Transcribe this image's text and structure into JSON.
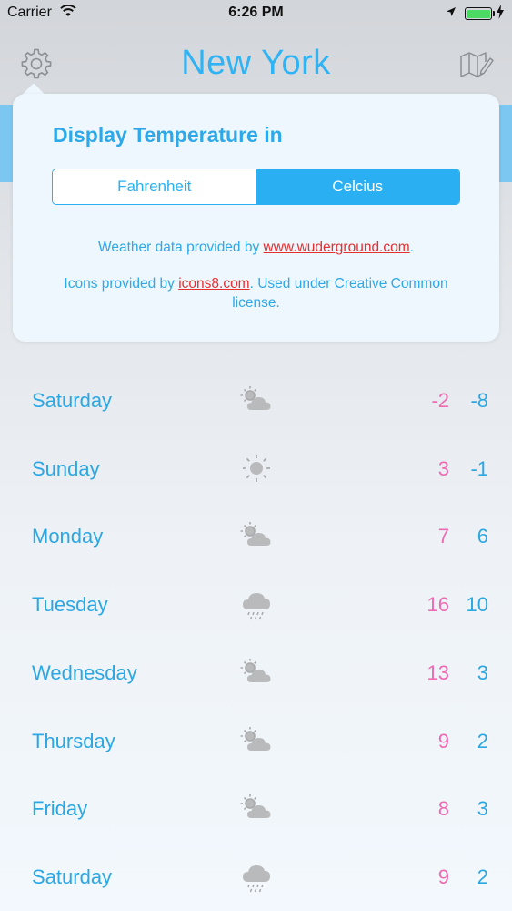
{
  "status_bar": {
    "carrier": "Carrier",
    "time": "6:26 PM"
  },
  "header": {
    "city": "New York",
    "settings_icon": "gear-icon",
    "map_icon": "map-edit-icon"
  },
  "popover": {
    "title": "Display Temperature in",
    "options": [
      "Fahrenheit",
      "Celcius"
    ],
    "selected": "Celcius",
    "credit1_prefix": "Weather data provided by ",
    "credit1_link": "www.wuderground.com",
    "credit1_suffix": ".",
    "credit2_prefix": "Icons provided by ",
    "credit2_link": "icons8.com",
    "credit2_suffix": ". Used under Creative Common license."
  },
  "forecast": [
    {
      "day": "Saturday",
      "icon": "partly-cloudy-icon",
      "high": "-2",
      "low": "-8"
    },
    {
      "day": "Sunday",
      "icon": "sun-icon",
      "high": "3",
      "low": "-1"
    },
    {
      "day": "Monday",
      "icon": "partly-cloudy-icon",
      "high": "7",
      "low": "6"
    },
    {
      "day": "Tuesday",
      "icon": "rain-cloud-icon",
      "high": "16",
      "low": "10"
    },
    {
      "day": "Wednesday",
      "icon": "partly-cloudy-icon",
      "high": "13",
      "low": "3"
    },
    {
      "day": "Thursday",
      "icon": "partly-cloudy-icon",
      "high": "9",
      "low": "2"
    },
    {
      "day": "Friday",
      "icon": "partly-cloudy-icon",
      "high": "8",
      "low": "3"
    },
    {
      "day": "Saturday",
      "icon": "rain-cloud-icon",
      "high": "9",
      "low": "2"
    }
  ],
  "colors": {
    "accent": "#2ba7e4",
    "high_temp": "#ee6bb2",
    "link": "#e53030"
  }
}
